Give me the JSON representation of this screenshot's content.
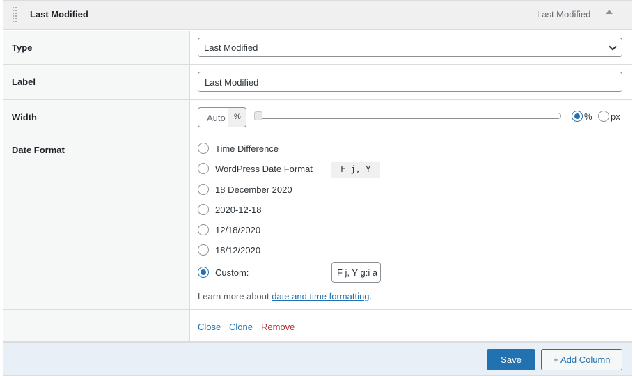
{
  "header": {
    "title": "Last Modified",
    "right_label": "Last Modified",
    "toggle_icon": "triangle-up-icon",
    "drag_icon": "drag-handle-icon"
  },
  "fields": {
    "type": {
      "label": "Type",
      "selected": "Last Modified"
    },
    "label": {
      "label": "Label",
      "value": "Last Modified"
    },
    "width": {
      "label": "Width",
      "placeholder": "Auto",
      "unit_label": "%",
      "slider_value": 0,
      "unit_options": [
        {
          "label": "%",
          "checked": true
        },
        {
          "label": "px",
          "checked": false
        }
      ]
    },
    "date_format": {
      "label": "Date Format",
      "options": [
        {
          "label": "Time Difference",
          "checked": false
        },
        {
          "label": "WordPress Date Format",
          "checked": false
        },
        {
          "label": "18 December 2020",
          "checked": false
        },
        {
          "label": "2020-12-18",
          "checked": false
        },
        {
          "label": "12/18/2020",
          "checked": false
        },
        {
          "label": "18/12/2020",
          "checked": false
        },
        {
          "label": "Custom:",
          "checked": true
        }
      ],
      "wp_format_code": "F j, Y",
      "custom_value": "F j, Y g:i a",
      "help_prefix": "Learn more about ",
      "help_link": "date and time formatting",
      "help_suffix": "."
    }
  },
  "actions": {
    "close": "Close",
    "clone": "Clone",
    "remove": "Remove"
  },
  "footer": {
    "save": "Save",
    "add_column": "+ Add Column"
  },
  "colors": {
    "accent": "#2271b1",
    "danger": "#b32d2e",
    "footer_bg": "#e9eff7"
  }
}
